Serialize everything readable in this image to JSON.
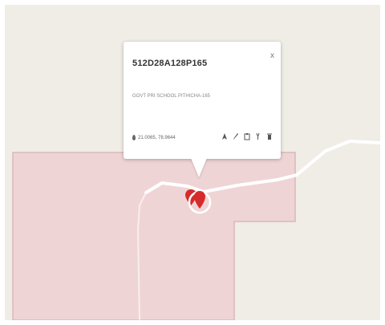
{
  "popup": {
    "title": "512D28A128P165",
    "close": "x",
    "description": "GOVT PRI SCHOOL PITHICHA-165",
    "coords": "21.0065, 78.9644"
  },
  "icons": {
    "coords": "pin-icon",
    "actions": [
      "directions-icon",
      "edit-icon",
      "clipboard-icon",
      "tool-icon",
      "trash-icon"
    ]
  },
  "colors": {
    "map_background": "#efede6",
    "area_fill": "#efd4d6",
    "area_stroke": "#dcb6ba",
    "road": "#ffffff",
    "marker": "#d52b2b"
  }
}
